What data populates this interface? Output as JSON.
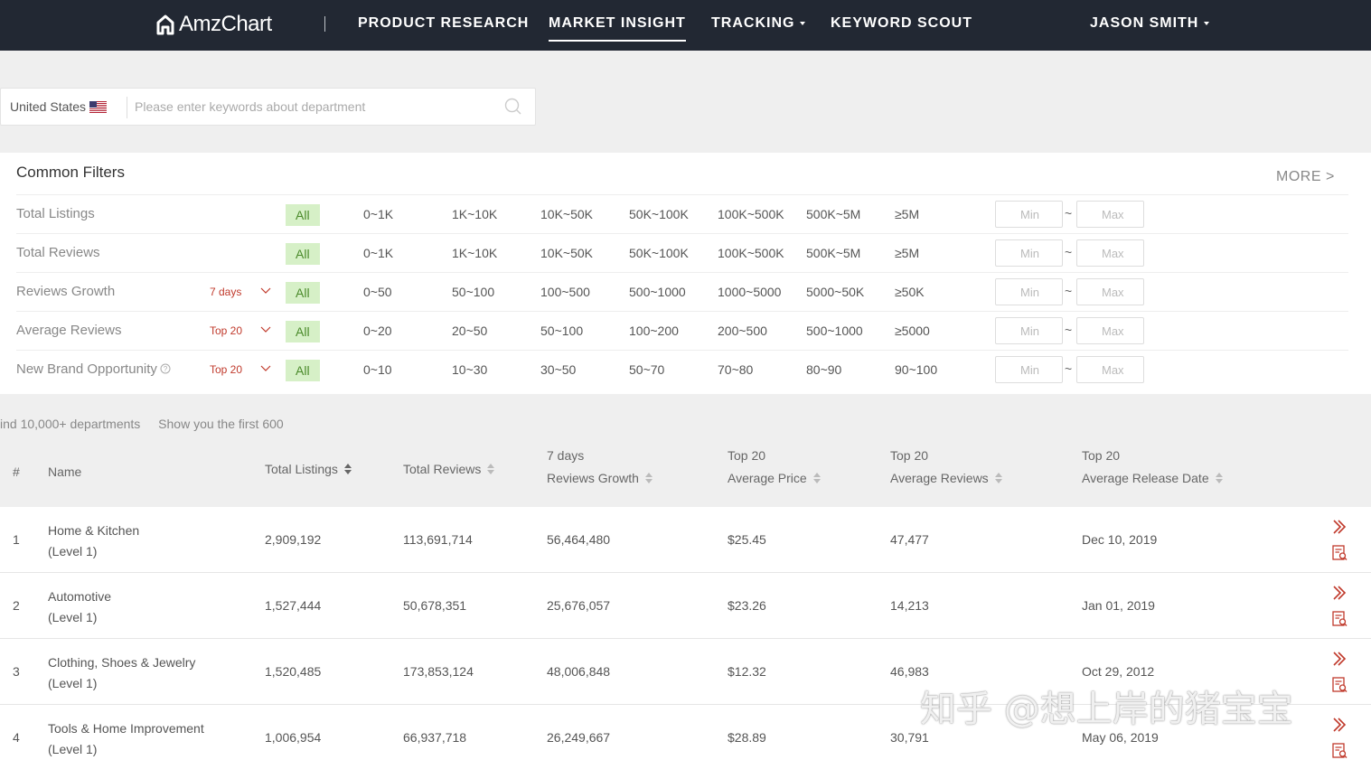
{
  "nav": {
    "logo": "AmzChart",
    "items": [
      {
        "label": "PRODUCT RESEARCH",
        "active": false,
        "dropdown": false
      },
      {
        "label": "MARKET INSIGHT",
        "active": true,
        "dropdown": false
      },
      {
        "label": "TRACKING",
        "active": false,
        "dropdown": true
      },
      {
        "label": "KEYWORD SCOUT",
        "active": false,
        "dropdown": false
      }
    ],
    "user": "JASON SMITH"
  },
  "search": {
    "country": "United States",
    "placeholder": "Please enter keywords about department"
  },
  "filters": {
    "title": "Common Filters",
    "more": "MORE >",
    "min_placeholder": "Min",
    "max_placeholder": "Max",
    "range_sep": "~",
    "rows": [
      {
        "label": "Total Listings",
        "period": "",
        "all": "All",
        "options": [
          "0~1K",
          "1K~10K",
          "10K~50K",
          "50K~100K",
          "100K~500K",
          "500K~5M",
          "≥5M"
        ]
      },
      {
        "label": "Total Reviews",
        "period": "",
        "all": "All",
        "options": [
          "0~1K",
          "1K~10K",
          "10K~50K",
          "50K~100K",
          "100K~500K",
          "500K~5M",
          "≥5M"
        ]
      },
      {
        "label": "Reviews Growth",
        "period": "7 days",
        "all": "All",
        "options": [
          "0~50",
          "50~100",
          "100~500",
          "500~1000",
          "1000~5000",
          "5000~50K",
          "≥50K"
        ]
      },
      {
        "label": "Average Reviews",
        "period": "Top 20",
        "all": "All",
        "options": [
          "0~20",
          "20~50",
          "50~100",
          "100~200",
          "200~500",
          "500~1000",
          "≥5000"
        ]
      },
      {
        "label": "New Brand Opportunity",
        "period": "Top 20",
        "all": "All",
        "options": [
          "0~10",
          "10~30",
          "30~50",
          "50~70",
          "70~80",
          "80~90",
          "90~100"
        ]
      }
    ]
  },
  "results": {
    "found": "ind 10,000+ departments",
    "shown": "Show you the first 600"
  },
  "table": {
    "headers": {
      "index": "#",
      "name": "Name",
      "total_listings": "Total Listings",
      "total_reviews": "Total Reviews",
      "growth_top": "7 days",
      "growth": "Reviews Growth",
      "price_top": "Top 20",
      "price": "Average Price",
      "reviews_top": "Top 20",
      "reviews": "Average Reviews",
      "release_top": "Top 20",
      "release": "Average Release Date"
    },
    "rows": [
      {
        "index": "1",
        "name": "Home & Kitchen",
        "level": "(Level 1)",
        "total_listings": "2,909,192",
        "total_reviews": "113,691,714",
        "growth": "56,464,480",
        "price": "$25.45",
        "reviews": "47,477",
        "release": "Dec 10, 2019"
      },
      {
        "index": "2",
        "name": "Automotive",
        "level": "(Level 1)",
        "total_listings": "1,527,444",
        "total_reviews": "50,678,351",
        "growth": "25,676,057",
        "price": "$23.26",
        "reviews": "14,213",
        "release": "Jan 01, 2019"
      },
      {
        "index": "3",
        "name": "Clothing, Shoes & Jewelry",
        "level": "(Level 1)",
        "total_listings": "1,520,485",
        "total_reviews": "173,853,124",
        "growth": "48,006,848",
        "price": "$12.32",
        "reviews": "46,983",
        "release": "Oct 29, 2012"
      },
      {
        "index": "4",
        "name": "Tools & Home Improvement",
        "level": "(Level 1)",
        "total_listings": "1,006,954",
        "total_reviews": "66,937,718",
        "growth": "26,249,667",
        "price": "$28.89",
        "reviews": "30,791",
        "release": "May 06, 2019"
      }
    ]
  },
  "watermark": "知乎 @想上岸的猪宝宝",
  "colors": {
    "nav_bg": "#222833",
    "accent_red": "#c0392b",
    "all_bg": "#d6f0c7"
  }
}
